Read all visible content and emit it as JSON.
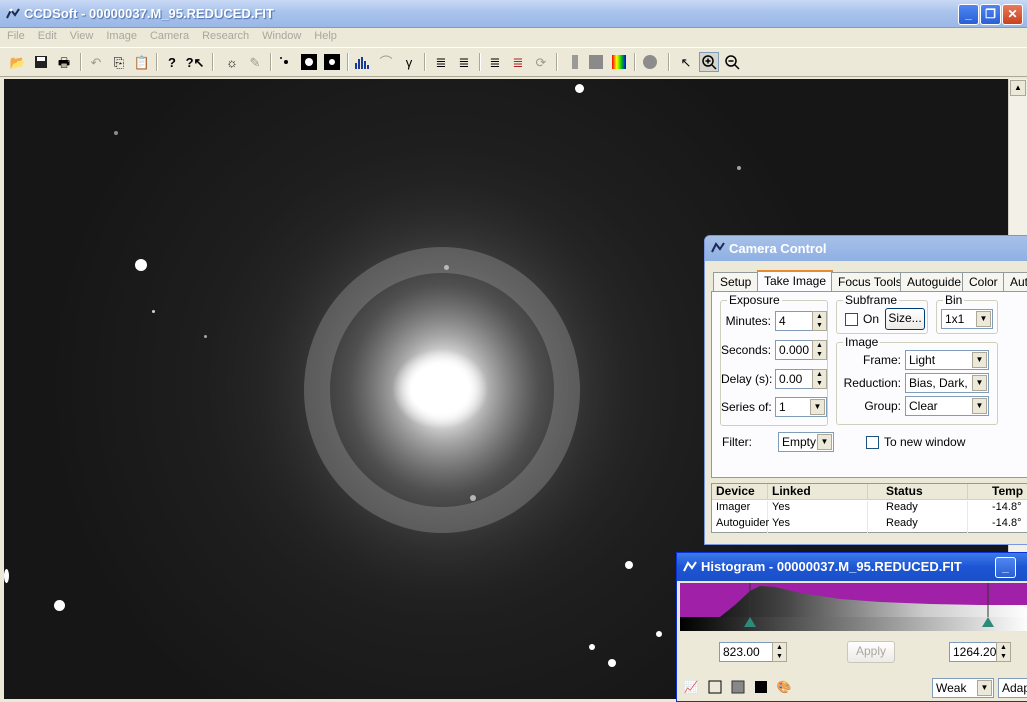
{
  "window": {
    "title": "CCDSoft  - 00000037.M_95.REDUCED.FIT",
    "buttons": {
      "minimize": "_",
      "restore": "❐",
      "close": "✕"
    }
  },
  "menu": [
    "File",
    "Edit",
    "View",
    "Image",
    "Camera",
    "Research",
    "Window",
    "Help"
  ],
  "toolbar_icons": [
    "open-icon",
    "save-icon",
    "print-icon",
    "undo-icon",
    "copy-icon",
    "paste-icon",
    "help-icon",
    "context-help-icon",
    "brightness-icon",
    "eraser-icon",
    "stars-small-icon",
    "stars-medium-icon",
    "stars-large-icon",
    "histogram-icon",
    "curve-icon",
    "gamma-icon",
    "stack-icon",
    "stack-align-icon",
    "color-stack-icon",
    "rgb-stack-icon",
    "refresh-stack-icon",
    "gray-bar-icon",
    "gray-box-icon",
    "spectrum-icon",
    "circle-icon",
    "pointer-icon",
    "zoom-in-icon",
    "zoom-out-icon"
  ],
  "camera_control": {
    "title": "Camera Control",
    "tabs": [
      "Setup",
      "Take Image",
      "Focus Tools",
      "Autoguide",
      "Color",
      "Auto"
    ],
    "active_tab": "Take Image",
    "exposure": {
      "label": "Exposure",
      "minutes_label": "Minutes:",
      "minutes": "4",
      "seconds_label": "Seconds:",
      "seconds": "0.000",
      "delay_label": "Delay (s):",
      "delay": "0.00",
      "series_label": "Series of:",
      "series": "1"
    },
    "subframe": {
      "label": "Subframe",
      "on_label": "On",
      "size_button": "Size..."
    },
    "bin": {
      "label": "Bin",
      "value": "1x1"
    },
    "image": {
      "label": "Image",
      "frame_label": "Frame:",
      "frame": "Light",
      "reduction_label": "Reduction:",
      "reduction": "Bias, Dark, F",
      "group_label": "Group:",
      "group": "Clear"
    },
    "filter": {
      "label": "Filter:",
      "value": "Empty"
    },
    "to_new_window": "To new window",
    "devices": {
      "headers": [
        "Device",
        "Linked",
        "Status",
        "Temp"
      ],
      "rows": [
        [
          "Imager",
          "Yes",
          "Ready",
          "-14.8°"
        ],
        [
          "Autoguider",
          "Yes",
          "Ready",
          "-14.8°"
        ]
      ]
    }
  },
  "histogram": {
    "title": "Histogram - 00000037.M_95.REDUCED.FIT",
    "low": "823.00",
    "high": "1264.20",
    "apply_button": "Apply",
    "mode": "Weak",
    "mode2": "Adap",
    "low_fraction": 0.2,
    "high_fraction": 0.88
  },
  "colors": {
    "histogram_bg": "#a020a8",
    "marker": "#2b8a7a"
  }
}
